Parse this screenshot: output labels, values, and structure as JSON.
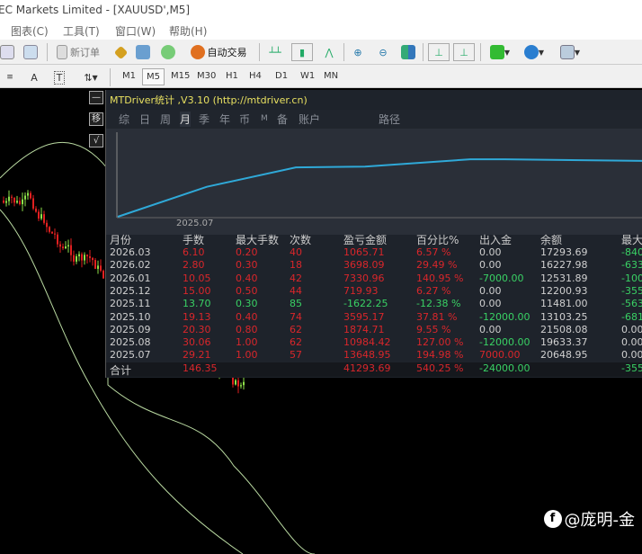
{
  "window": {
    "title": "EC Markets Limited - [XAUUSD',M5]"
  },
  "menu": [
    "图表(C)",
    "工具(T)",
    "窗口(W)",
    "帮助(H)"
  ],
  "toolbar": {
    "new_order": "新订单",
    "auto_trade": "自动交易"
  },
  "timeframes": [
    "M1",
    "M5",
    "M15",
    "M30",
    "H1",
    "H4",
    "D1",
    "W1",
    "MN"
  ],
  "active_timeframe": "M5",
  "toolbar2": {
    "text_a": "A",
    "text_t": "T"
  },
  "side_buttons": [
    "—",
    "移",
    "√"
  ],
  "panel": {
    "title": "MTDriver统计 ,V3.10 (http://mtdriver.cn)",
    "tabs": [
      "综",
      "日",
      "周",
      "月",
      "季",
      "年",
      "币",
      "M",
      "备",
      "账户",
      "路径"
    ],
    "active_tab": "月",
    "equity_xlabel": "2025.07",
    "equity_curve": [
      0,
      0.37,
      0.61,
      0.62,
      0.71,
      0.71,
      0.69
    ],
    "line_color": "#2fa9d8",
    "columns": [
      "月份",
      "手数",
      "最大手数",
      "次数",
      "盈亏金额",
      "百分比%",
      "出入金",
      "余额",
      "最大"
    ],
    "rows": [
      {
        "c": [
          "2026.03",
          "6.10",
          "0.20",
          "40",
          "1065.71",
          "6.57 %",
          "0.00",
          "17293.69",
          "-840"
        ],
        "s": "red",
        "f": "wht"
      },
      {
        "c": [
          "2026.02",
          "2.80",
          "0.30",
          "18",
          "3698.09",
          "29.49 %",
          "0.00",
          "16227.98",
          "-633"
        ],
        "s": "red",
        "f": "wht"
      },
      {
        "c": [
          "2026.01",
          "10.05",
          "0.40",
          "42",
          "7330.96",
          "140.95 %",
          "-7000.00",
          "12531.89",
          "-100"
        ],
        "s": "red",
        "f": "grn"
      },
      {
        "c": [
          "2025.12",
          "15.00",
          "0.50",
          "44",
          "719.93",
          "6.27 %",
          "0.00",
          "12200.93",
          "-355"
        ],
        "s": "red",
        "f": "wht"
      },
      {
        "c": [
          "2025.11",
          "13.70",
          "0.30",
          "85",
          "-1622.25",
          "-12.38 %",
          "0.00",
          "11481.00",
          "-563"
        ],
        "s": "grn",
        "f": "wht"
      },
      {
        "c": [
          "2025.10",
          "19.13",
          "0.40",
          "74",
          "3595.17",
          "37.81 %",
          "-12000.00",
          "13103.25",
          "-681"
        ],
        "s": "red",
        "f": "grn"
      },
      {
        "c": [
          "2025.09",
          "20.30",
          "0.80",
          "62",
          "1874.71",
          "9.55 %",
          "0.00",
          "21508.08",
          "0.00"
        ],
        "s": "red",
        "f": "wht"
      },
      {
        "c": [
          "2025.08",
          "30.06",
          "1.00",
          "62",
          "10984.42",
          "127.00 %",
          "-12000.00",
          "19633.37",
          "0.00"
        ],
        "s": "red",
        "f": "grn"
      },
      {
        "c": [
          "2025.07",
          "29.21",
          "1.00",
          "57",
          "13648.95",
          "194.98 %",
          "7000.00",
          "20648.95",
          "0.00"
        ],
        "s": "red",
        "f": "red"
      }
    ],
    "total": {
      "label": "合计",
      "lots": "146.35",
      "pl": "41293.69",
      "pct": "540.25 %",
      "flow": "-24000.00",
      "max": "-355"
    }
  },
  "watermark": "@庞明-金"
}
